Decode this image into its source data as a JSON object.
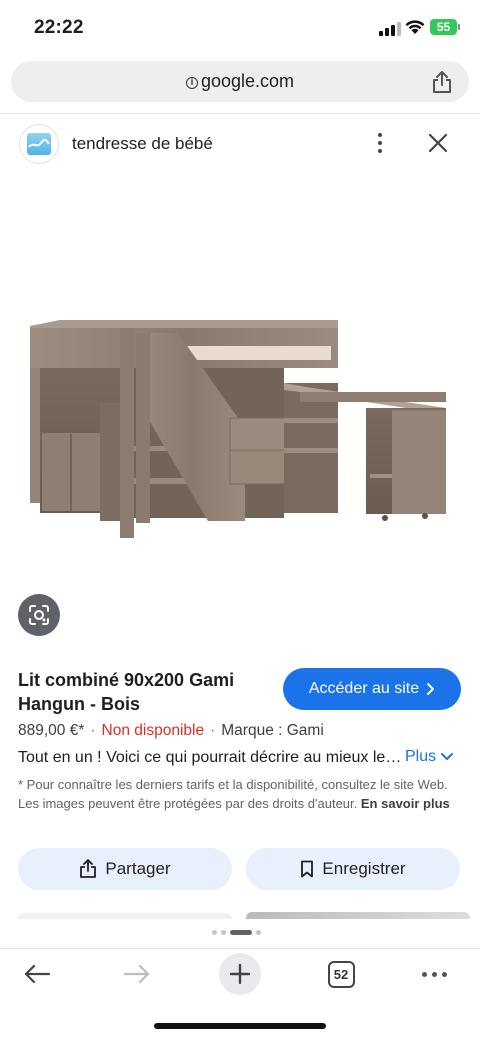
{
  "status_bar": {
    "time": "22:22",
    "battery": "55"
  },
  "browser": {
    "url": "google.com"
  },
  "site": {
    "name": "tendresse de bébé"
  },
  "product": {
    "title": "Lit combiné 90x200 Gami Hangun - Bois",
    "visit_label": "Accéder au site",
    "price": "889,00 €*",
    "availability": "Non disponible",
    "brand": "Marque : Gami",
    "description": "Tout en un ! Voici ce qui pourrait décrire au mieux le lit combiné",
    "more_label": "Plus",
    "disclaimer": "* Pour connaître les derniers tarifs et la disponibilité, consultez le site Web. Les images peuvent être protégées par des droits d'auteur.",
    "learn_more": "En savoir plus"
  },
  "actions": {
    "share_label": "Partager",
    "save_label": "Enregistrer"
  },
  "toolbar": {
    "tab_count": "52"
  },
  "colors": {
    "accent": "#1a73e8",
    "unavailable": "#d93025",
    "battery": "#34c759"
  }
}
